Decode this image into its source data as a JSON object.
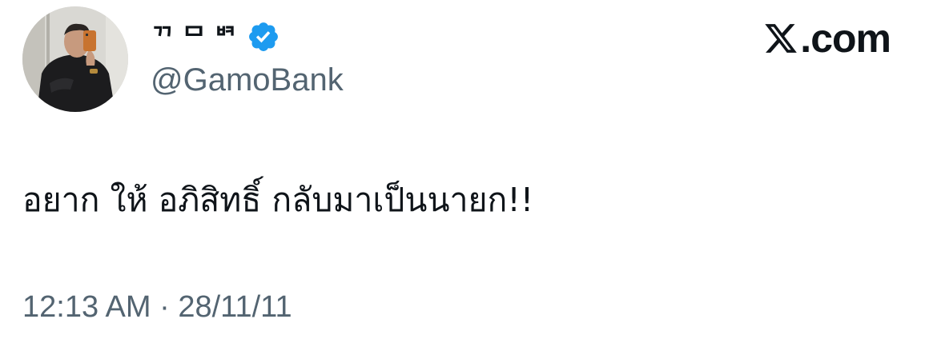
{
  "author": {
    "display_name": "ᄁᄆᄇᄏ",
    "handle": "@GamoBank",
    "verified": true,
    "avatar_icon": "person-photo-avatar"
  },
  "brand": {
    "icon": "x-logo-icon",
    "text": ".com"
  },
  "tweet": {
    "text": "อยาก ให้ อภิสิทธิ์ กลับมาเป็นนายก!!",
    "timestamp": "12:13 AM · 28/11/11"
  },
  "colors": {
    "text_primary": "#0f1419",
    "text_secondary": "#536471",
    "verified_blue": "#1d9bf0",
    "background": "#ffffff"
  }
}
